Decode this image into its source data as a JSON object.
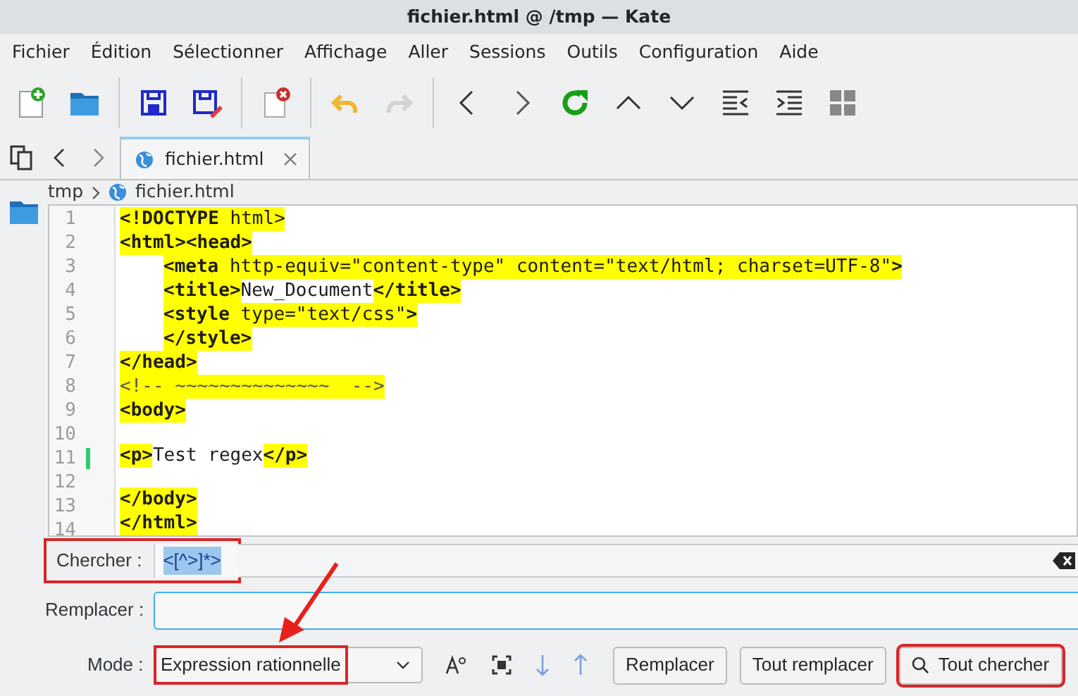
{
  "window": {
    "title": "fichier.html @ /tmp — Kate"
  },
  "menu": [
    "Fichier",
    "Édition",
    "Sélectionner",
    "Affichage",
    "Aller",
    "Sessions",
    "Outils",
    "Configuration",
    "Aide"
  ],
  "toolbar": [
    {
      "kind": "new",
      "disabled": false
    },
    {
      "kind": "open",
      "disabled": false
    },
    {
      "kind": "separator"
    },
    {
      "kind": "save",
      "disabled": false
    },
    {
      "kind": "saveas",
      "disabled": false
    },
    {
      "kind": "separator"
    },
    {
      "kind": "close",
      "disabled": false
    },
    {
      "kind": "separator"
    },
    {
      "kind": "undo",
      "disabled": false
    },
    {
      "kind": "redo",
      "disabled": true
    },
    {
      "kind": "separator"
    },
    {
      "kind": "back",
      "disabled": false
    },
    {
      "kind": "forward",
      "disabled": false
    },
    {
      "kind": "reload",
      "disabled": false
    },
    {
      "kind": "up",
      "disabled": false
    },
    {
      "kind": "down",
      "disabled": false
    },
    {
      "kind": "indent",
      "disabled": false
    },
    {
      "kind": "unindent",
      "disabled": false
    },
    {
      "kind": "grid",
      "disabled": false
    }
  ],
  "tabs": [
    {
      "label": "fichier.html",
      "selected": true
    }
  ],
  "breadcrumb": [
    "tmp",
    "fichier.html"
  ],
  "editor": {
    "lines": [
      {
        "number": "1",
        "indented": false,
        "modified": false,
        "segments": [
          {
            "text": "<!DOCTYPE",
            "kind": "tag",
            "match": true
          },
          {
            "text": " html>",
            "kind": "attr",
            "match": true
          }
        ]
      },
      {
        "number": "2",
        "indented": false,
        "modified": false,
        "segments": [
          {
            "text": "<html><head>",
            "kind": "tag",
            "match": true
          }
        ]
      },
      {
        "number": "3",
        "indented": true,
        "modified": false,
        "segments": [
          {
            "text": "<meta",
            "kind": "tag",
            "match": true
          },
          {
            "text": " http-equiv=\"content-type\" content=\"text/html; charset=UTF-8\"",
            "kind": "attr",
            "match": true
          },
          {
            "text": ">",
            "kind": "tag",
            "match": true
          }
        ]
      },
      {
        "number": "4",
        "indented": true,
        "modified": false,
        "segments": [
          {
            "text": "<title>",
            "kind": "tag",
            "match": true
          },
          {
            "text": "New_Document",
            "kind": "text",
            "match": false
          },
          {
            "text": "</title>",
            "kind": "tag",
            "match": true
          }
        ]
      },
      {
        "number": "5",
        "indented": true,
        "modified": false,
        "segments": [
          {
            "text": "<style",
            "kind": "tag",
            "match": true
          },
          {
            "text": " type=\"text/css\"",
            "kind": "attr",
            "match": true
          },
          {
            "text": ">",
            "kind": "tag",
            "match": true
          }
        ]
      },
      {
        "number": "6",
        "indented": true,
        "modified": false,
        "segments": [
          {
            "text": "</style>",
            "kind": "tag",
            "match": true
          }
        ]
      },
      {
        "number": "7",
        "indented": false,
        "modified": false,
        "segments": [
          {
            "text": "</head>",
            "kind": "tag",
            "match": true
          }
        ]
      },
      {
        "number": "8",
        "indented": false,
        "modified": false,
        "segments": [
          {
            "text": "<!-- ~~~~~~~~~~~~~~  -->",
            "kind": "comment",
            "match": true
          }
        ]
      },
      {
        "number": "9",
        "indented": false,
        "modified": false,
        "segments": [
          {
            "text": "<body>",
            "kind": "tag",
            "match": true
          }
        ]
      },
      {
        "number": "10",
        "modified": false
      },
      {
        "number": "11",
        "indented": false,
        "modified": true,
        "segments": [
          {
            "text": "<p>",
            "kind": "tag",
            "match": true
          },
          {
            "text": "Test regex",
            "kind": "text",
            "match": false
          },
          {
            "text": "</p>",
            "kind": "tag",
            "match": true
          }
        ]
      },
      {
        "number": "12",
        "modified": false
      },
      {
        "number": "13",
        "indented": false,
        "modified": false,
        "segments": [
          {
            "text": "</body>",
            "kind": "tag",
            "match": true
          }
        ]
      },
      {
        "number": "14",
        "indented": false,
        "modified": false,
        "segments": [
          {
            "text": "</html>",
            "kind": "tag",
            "match": true
          }
        ]
      }
    ]
  },
  "search_bar": {
    "find_label": "Chercher :",
    "find_value": "<[^>]*>",
    "find_annotated": true,
    "replace_label": "Remplacer :",
    "mode_label": "Mode :",
    "mode_value": "Expression rationnelle",
    "mode_annotated": true,
    "buttons": [
      {
        "label": "Remplacer",
        "annotated": false,
        "icon": false
      },
      {
        "label": "Tout remplacer",
        "annotated": false,
        "icon": false
      },
      {
        "label": "Tout chercher",
        "annotated": true,
        "icon": true
      }
    ]
  }
}
